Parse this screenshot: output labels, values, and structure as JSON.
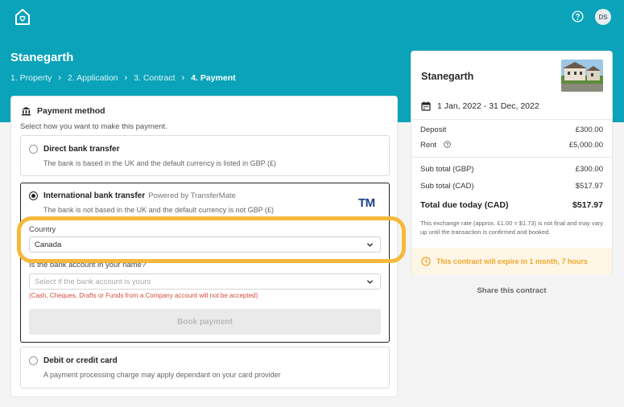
{
  "header": {
    "logo_icon": "house-heart-icon",
    "help_icon": "question-circle-icon",
    "avatar_initials": "DS",
    "property_title": "Stanegarth",
    "steps": [
      {
        "label": "1. Property"
      },
      {
        "label": "2. Application"
      },
      {
        "label": "3. Contract"
      },
      {
        "label": "4. Payment"
      }
    ],
    "step_separator_icon": "chevron-right-icon"
  },
  "payment": {
    "heading": "Payment method",
    "heading_icon": "bank-icon",
    "subheading": "Select how you want to make this payment.",
    "options": [
      {
        "title": "Direct bank transfer",
        "description": "The bank is based in the UK and the default currency is listed in GBP (£)",
        "selected": false
      },
      {
        "title": "International bank transfer",
        "powered_by": "Powered by TransferMate",
        "description": "The bank is not based in the UK and the default currency is not GBP (£)",
        "logo_text": "TM",
        "selected": true
      },
      {
        "title": "Debit or credit card",
        "description": "A payment processing charge may apply dependant on your card provider",
        "selected": false
      }
    ],
    "country_label": "Country",
    "country_value": "Canada",
    "account_label": "Is the bank account in your name?",
    "account_placeholder": "Select if the bank account is yours",
    "warning": "(Cash, Cheques, Drafts or Funds from a Company account will not be accepted)",
    "book_button": "Book payment"
  },
  "summary": {
    "title": "Stanegarth",
    "dates": "1 Jan, 2022 - 31 Dec, 2022",
    "rows": [
      {
        "label": "Deposit",
        "value": "£300.00"
      },
      {
        "label": "Rent",
        "value": "£5,000.00"
      },
      {
        "label": "Sub total (GBP)",
        "value": "£300.00"
      },
      {
        "label": "Sub total (CAD)",
        "value": "$517.97"
      },
      {
        "label": "Total due today (CAD)",
        "value": "$517.97"
      }
    ],
    "note": "This exchange rate (approx. £1.00 = $1.73) is not final and may vary up until the transaction is confirmed and booked.",
    "expiry": "This contract will expire in 1 month, 7 hours",
    "share": "Share this contract"
  },
  "colors": {
    "brand": "#0aa3b9",
    "highlight": "#f6b93b",
    "warning": "#d34b3d",
    "expiry_text": "#f0a72b"
  }
}
